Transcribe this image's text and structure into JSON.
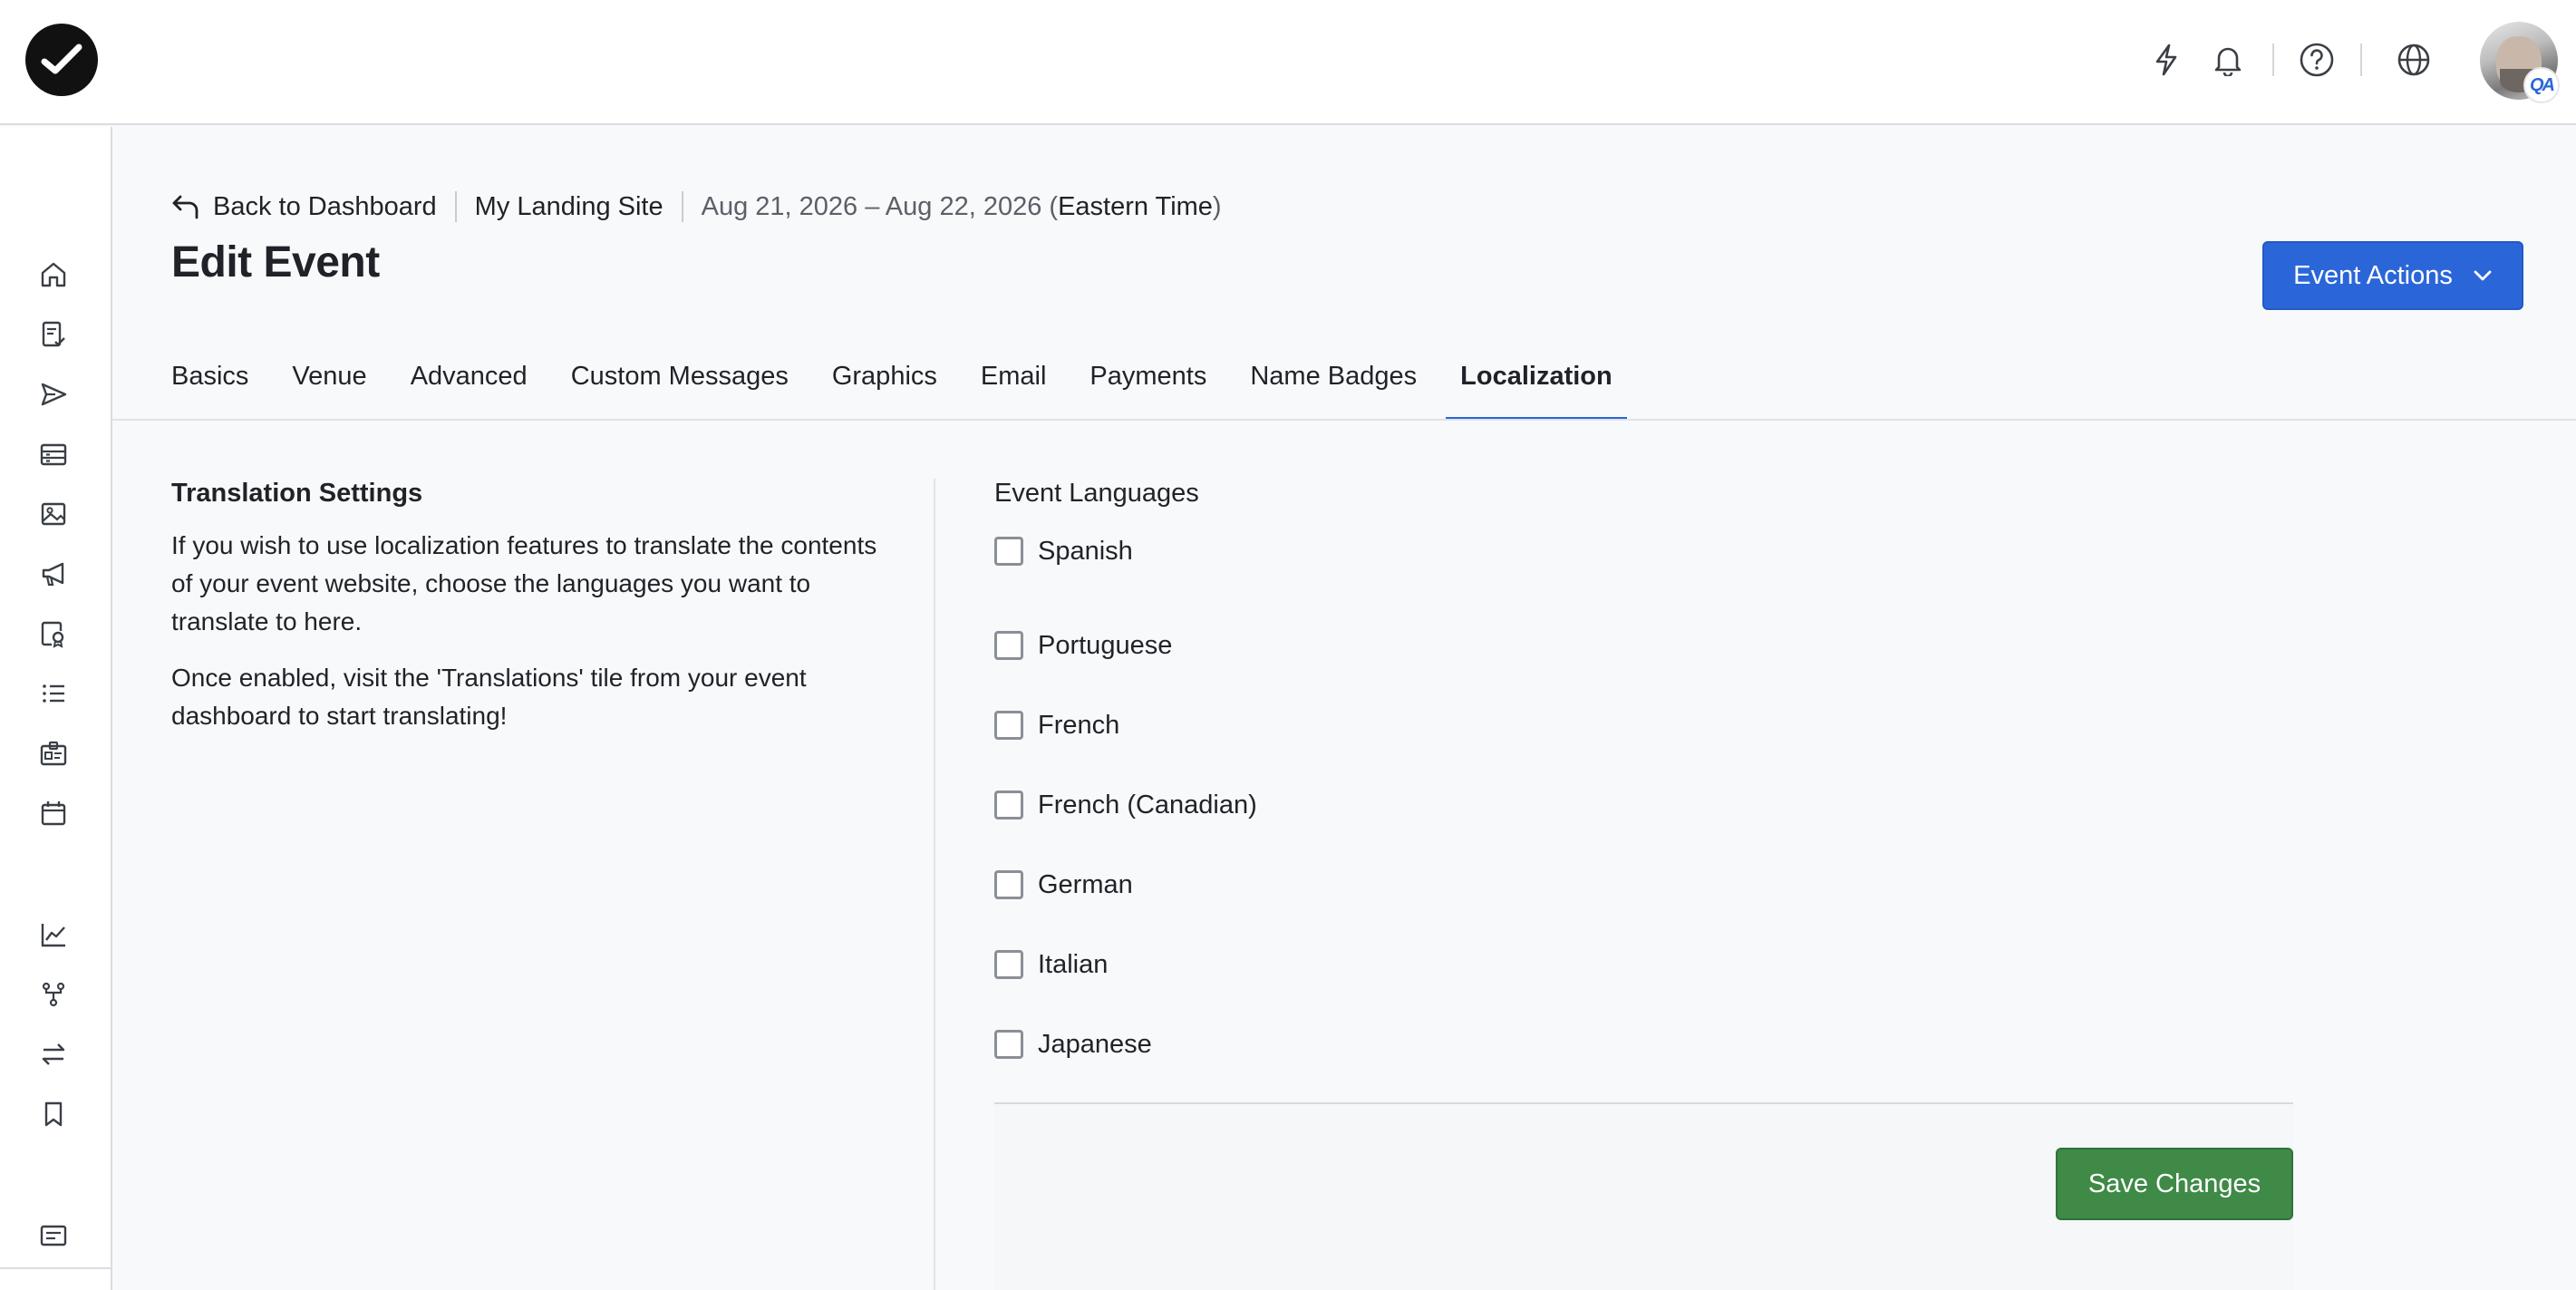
{
  "header": {
    "back_label": "Back to Dashboard",
    "site_name": "My Landing Site",
    "date_range": "Aug 21, 2026 – Aug 22, 2026",
    "timezone_open": " (",
    "timezone": "Eastern Time",
    "timezone_close": ")",
    "title": "Edit Event",
    "actions_label": "Event Actions"
  },
  "user": {
    "badge_initials": "QA"
  },
  "sidebar": {
    "icons": [
      "home-icon",
      "checklist-icon",
      "send-icon",
      "registration-icon",
      "image-icon",
      "megaphone-icon",
      "badge-search-icon",
      "list-icon",
      "id-card-icon",
      "calendar-icon",
      "chart-icon",
      "flow-icon",
      "swap-icon",
      "bookmark-icon",
      "message-icon"
    ]
  },
  "tabs": [
    {
      "label": "Basics"
    },
    {
      "label": "Venue"
    },
    {
      "label": "Advanced"
    },
    {
      "label": "Custom Messages"
    },
    {
      "label": "Graphics"
    },
    {
      "label": "Email"
    },
    {
      "label": "Payments"
    },
    {
      "label": "Name Badges"
    },
    {
      "label": "Localization",
      "active": true
    }
  ],
  "translation": {
    "title": "Translation Settings",
    "para1": "If you wish to use localization features to translate the contents of your event website, choose the languages you want to translate to here.",
    "para2": "Once enabled, visit the 'Translations' tile from your event dashboard to start translating!"
  },
  "languages": {
    "label": "Event Languages",
    "items": [
      {
        "label": "Spanish",
        "checked": false
      },
      {
        "label": "Portuguese",
        "checked": false
      },
      {
        "label": "French",
        "checked": false
      },
      {
        "label": "French (Canadian)",
        "checked": false
      },
      {
        "label": "German",
        "checked": false
      },
      {
        "label": "Italian",
        "checked": false
      },
      {
        "label": "Japanese",
        "checked": false
      }
    ]
  },
  "footer": {
    "save_label": "Save Changes"
  },
  "colors": {
    "primary": "#2b66d9",
    "save": "#3e8a46"
  }
}
